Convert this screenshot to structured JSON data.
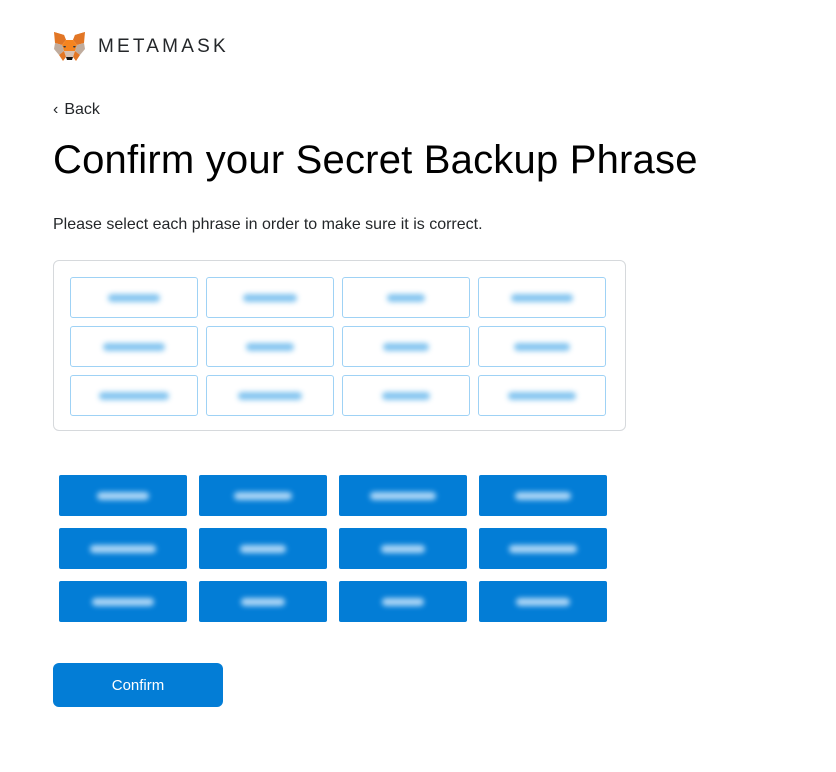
{
  "header": {
    "brand": "METAMASK",
    "logo_icon": "fox-icon"
  },
  "nav": {
    "back_icon": "chevron-left-icon",
    "back_label": "Back"
  },
  "main": {
    "title": "Confirm your Secret Backup Phrase",
    "instructions": "Please select each phrase in order to make sure it is correct."
  },
  "selected_words": {
    "count": 12,
    "note_blurred": true
  },
  "word_options": {
    "count": 12,
    "note_blurred": true
  },
  "actions": {
    "confirm_label": "Confirm"
  },
  "colors": {
    "primary": "#037dd6",
    "slot_border": "#9fd2f5",
    "container_border": "#d6d9dc"
  }
}
